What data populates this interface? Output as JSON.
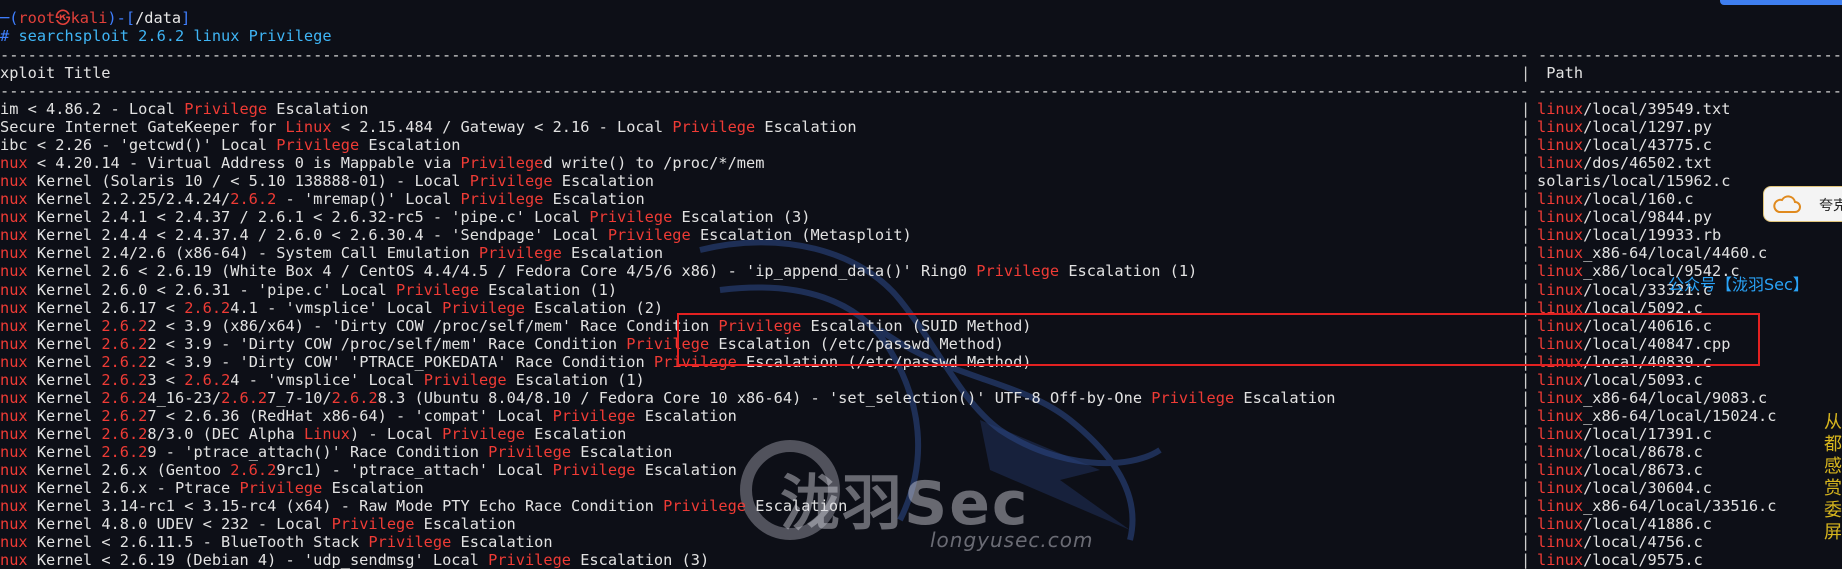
{
  "prompt": {
    "lead": "─(",
    "user": "root",
    "at": "㉿",
    "host": "kali",
    "mid": ")-[",
    "dir": "/data",
    "end": "]",
    "hash": "#",
    "command": "searchsploit 2.6.2 linux Privilege"
  },
  "header": {
    "title_col": "xploit Title",
    "path_col": "Path",
    "separator": "|"
  },
  "rows": [
    {
      "title": [
        [
          "im < 4.86.2 - Local ",
          0
        ],
        [
          "Privilege",
          1
        ],
        [
          " Escalation",
          0
        ]
      ],
      "path": [
        [
          "linux",
          1
        ],
        [
          "/local/39549.txt",
          0
        ]
      ]
    },
    {
      "title": [
        [
          "Secure Internet GateKeeper for ",
          0
        ],
        [
          "Linux",
          1
        ],
        [
          " < 2.15.484 / Gateway < 2.16 - Local ",
          0
        ],
        [
          "Privilege",
          1
        ],
        [
          " Escalation",
          0
        ]
      ],
      "path": [
        [
          "linux",
          1
        ],
        [
          "/local/1297.py",
          0
        ]
      ]
    },
    {
      "title": [
        [
          "ibc < 2.26 - 'getcwd()' Local ",
          0
        ],
        [
          "Privilege",
          1
        ],
        [
          " Escalation",
          0
        ]
      ],
      "path": [
        [
          "linux",
          1
        ],
        [
          "/local/43775.c",
          0
        ]
      ]
    },
    {
      "title": [
        [
          "nux",
          1
        ],
        [
          " < 4.20.14 - Virtual Address 0 is Mappable via ",
          0
        ],
        [
          "Privilege",
          1
        ],
        [
          "d write() to /proc/*/mem",
          0
        ]
      ],
      "path": [
        [
          "linux",
          1
        ],
        [
          "/dos/46502.txt",
          0
        ]
      ]
    },
    {
      "title": [
        [
          "nux",
          1
        ],
        [
          " Kernel (Solaris 10 / < 5.10 138888-01) - Local ",
          0
        ],
        [
          "Privilege",
          1
        ],
        [
          " Escalation",
          0
        ]
      ],
      "path": [
        [
          "solaris/local/15962.c",
          0
        ]
      ]
    },
    {
      "title": [
        [
          "nux",
          1
        ],
        [
          " Kernel 2.2.25/2.4.24/",
          0
        ],
        [
          "2.6.2",
          1
        ],
        [
          " - 'mremap()' Local ",
          0
        ],
        [
          "Privilege",
          1
        ],
        [
          " Escalation",
          0
        ]
      ],
      "path": [
        [
          "linux",
          1
        ],
        [
          "/local/160.c",
          0
        ]
      ]
    },
    {
      "title": [
        [
          "nux",
          1
        ],
        [
          " Kernel 2.4.1 < 2.4.37 / 2.6.1 < 2.6.32-rc5 - 'pipe.c' Local ",
          0
        ],
        [
          "Privilege",
          1
        ],
        [
          " Escalation (3)",
          0
        ]
      ],
      "path": [
        [
          "linux",
          1
        ],
        [
          "/local/9844.py",
          0
        ]
      ]
    },
    {
      "title": [
        [
          "nux",
          1
        ],
        [
          " Kernel 2.4.4 < 2.4.37.4 / 2.6.0 < 2.6.30.4 - 'Sendpage' Local ",
          0
        ],
        [
          "Privilege",
          1
        ],
        [
          " Escalation (Metasploit)",
          0
        ]
      ],
      "path": [
        [
          "linux",
          1
        ],
        [
          "/local/19933.rb",
          0
        ]
      ]
    },
    {
      "title": [
        [
          "nux",
          1
        ],
        [
          " Kernel 2.4/2.6 (x86-64) - System Call Emulation ",
          0
        ],
        [
          "Privilege",
          1
        ],
        [
          " Escalation",
          0
        ]
      ],
      "path": [
        [
          "linux",
          1
        ],
        [
          "_x86-64/local/4460.c",
          0
        ]
      ]
    },
    {
      "title": [
        [
          "nux",
          1
        ],
        [
          " Kernel 2.6 < 2.6.19 (White Box 4 / CentOS 4.4/4.5 / Fedora Core 4/5/6 x86) - 'ip_append_data()' Ring0 ",
          0
        ],
        [
          "Privilege",
          1
        ],
        [
          " Escalation (1)",
          0
        ]
      ],
      "path": [
        [
          "linux",
          1
        ],
        [
          "_x86/local/9542.c",
          0
        ]
      ]
    },
    {
      "title": [
        [
          "nux",
          1
        ],
        [
          " Kernel 2.6.0 < 2.6.31 - 'pipe.c' Local ",
          0
        ],
        [
          "Privilege",
          1
        ],
        [
          " Escalation (1)",
          0
        ]
      ],
      "path": [
        [
          "linux",
          1
        ],
        [
          "/local/33321.c",
          0
        ]
      ]
    },
    {
      "title": [
        [
          "nux",
          1
        ],
        [
          " Kernel 2.6.17 < ",
          0
        ],
        [
          "2.6.2",
          1
        ],
        [
          "4.1 - 'vmsplice' Local ",
          0
        ],
        [
          "Privilege",
          1
        ],
        [
          " Escalation (2)",
          0
        ]
      ],
      "path": [
        [
          "linux",
          1
        ],
        [
          "/local/5092.c",
          0
        ]
      ]
    },
    {
      "title": [
        [
          "nux",
          1
        ],
        [
          " Kernel ",
          0
        ],
        [
          "2.6.2",
          1
        ],
        [
          "2 < 3.9 (x86/x64) - 'Dirty COW /proc/self/mem' Race Condition ",
          0
        ],
        [
          "Privilege",
          1
        ],
        [
          " Escalation (SUID Method)",
          0
        ]
      ],
      "path": [
        [
          "linux",
          1
        ],
        [
          "/local/40616.c",
          0
        ]
      ]
    },
    {
      "title": [
        [
          "nux",
          1
        ],
        [
          " Kernel ",
          0
        ],
        [
          "2.6.2",
          1
        ],
        [
          "2 < 3.9 - 'Dirty COW /proc/self/mem' Race Condition ",
          0
        ],
        [
          "Privilege",
          1
        ],
        [
          " Escalation (/etc/passwd Method)",
          0
        ]
      ],
      "path": [
        [
          "linux",
          1
        ],
        [
          "/local/40847.cpp",
          0
        ]
      ]
    },
    {
      "title": [
        [
          "nux",
          1
        ],
        [
          " Kernel ",
          0
        ],
        [
          "2.6.2",
          1
        ],
        [
          "2 < 3.9 - 'Dirty COW' 'PTRACE_POKEDATA' Race Condition ",
          0
        ],
        [
          "Privilege",
          1
        ],
        [
          " Escalation (/etc/passwd Method)",
          0
        ]
      ],
      "path": [
        [
          "linux",
          1
        ],
        [
          "/local/40839.c",
          0
        ]
      ]
    },
    {
      "title": [
        [
          "nux",
          1
        ],
        [
          " Kernel ",
          0
        ],
        [
          "2.6.2",
          1
        ],
        [
          "3 < ",
          0
        ],
        [
          "2.6.2",
          1
        ],
        [
          "4 - 'vmsplice' Local ",
          0
        ],
        [
          "Privilege",
          1
        ],
        [
          " Escalation (1)",
          0
        ]
      ],
      "path": [
        [
          "linux",
          1
        ],
        [
          "/local/5093.c",
          0
        ]
      ]
    },
    {
      "title": [
        [
          "nux",
          1
        ],
        [
          " Kernel ",
          0
        ],
        [
          "2.6.2",
          1
        ],
        [
          "4_16-23/",
          0
        ],
        [
          "2.6.2",
          1
        ],
        [
          "7_7-10/",
          0
        ],
        [
          "2.6.2",
          1
        ],
        [
          "8.3 (Ubuntu 8.04/8.10 / Fedora Core 10 x86-64) - 'set_selection()' UTF-8 Off-by-One ",
          0
        ],
        [
          "Privilege",
          1
        ],
        [
          " Escalation",
          0
        ]
      ],
      "path": [
        [
          "linux",
          1
        ],
        [
          "_x86-64/local/9083.c",
          0
        ]
      ]
    },
    {
      "title": [
        [
          "nux",
          1
        ],
        [
          " Kernel ",
          0
        ],
        [
          "2.6.2",
          1
        ],
        [
          "7 < 2.6.36 (RedHat x86-64) - 'compat' Local ",
          0
        ],
        [
          "Privilege",
          1
        ],
        [
          " Escalation",
          0
        ]
      ],
      "path": [
        [
          "linux",
          1
        ],
        [
          "_x86-64/local/15024.c",
          0
        ]
      ]
    },
    {
      "title": [
        [
          "nux",
          1
        ],
        [
          " Kernel ",
          0
        ],
        [
          "2.6.2",
          1
        ],
        [
          "8/3.0 (DEC Alpha ",
          0
        ],
        [
          "Linux",
          1
        ],
        [
          ") - Local ",
          0
        ],
        [
          "Privilege",
          1
        ],
        [
          " Escalation",
          0
        ]
      ],
      "path": [
        [
          "linux",
          1
        ],
        [
          "/local/17391.c",
          0
        ]
      ]
    },
    {
      "title": [
        [
          "nux",
          1
        ],
        [
          " Kernel ",
          0
        ],
        [
          "2.6.2",
          1
        ],
        [
          "9 - 'ptrace_attach()' Race Condition ",
          0
        ],
        [
          "Privilege",
          1
        ],
        [
          " Escalation",
          0
        ]
      ],
      "path": [
        [
          "linux",
          1
        ],
        [
          "/local/8678.c",
          0
        ]
      ]
    },
    {
      "title": [
        [
          "nux",
          1
        ],
        [
          " Kernel 2.6.x (Gentoo ",
          0
        ],
        [
          "2.6.2",
          1
        ],
        [
          "9rc1) - 'ptrace_attach' Local ",
          0
        ],
        [
          "Privilege",
          1
        ],
        [
          " Escalation",
          0
        ]
      ],
      "path": [
        [
          "linux",
          1
        ],
        [
          "/local/8673.c",
          0
        ]
      ]
    },
    {
      "title": [
        [
          "nux",
          1
        ],
        [
          " Kernel 2.6.x - Ptrace ",
          0
        ],
        [
          "Privilege",
          1
        ],
        [
          " Escalation",
          0
        ]
      ],
      "path": [
        [
          "linux",
          1
        ],
        [
          "/local/30604.c",
          0
        ]
      ]
    },
    {
      "title": [
        [
          "nux",
          1
        ],
        [
          " Kernel 3.14-rc1 < 3.15-rc4 (x64) - Raw Mode PTY Echo Race Condition ",
          0
        ],
        [
          "Privilege",
          1
        ],
        [
          " Escalation",
          0
        ]
      ],
      "path": [
        [
          "linux",
          1
        ],
        [
          "_x86-64/local/33516.c",
          0
        ]
      ]
    },
    {
      "title": [
        [
          "nux",
          1
        ],
        [
          " Kernel 4.8.0 UDEV < 232 - Local ",
          0
        ],
        [
          "Privilege",
          1
        ],
        [
          " Escalation",
          0
        ]
      ],
      "path": [
        [
          "linux",
          1
        ],
        [
          "/local/41886.c",
          0
        ]
      ]
    },
    {
      "title": [
        [
          "nux",
          1
        ],
        [
          " Kernel < 2.6.11.5 - BlueTooth Stack ",
          0
        ],
        [
          "Privilege",
          1
        ],
        [
          " Escalation",
          0
        ]
      ],
      "path": [
        [
          "linux",
          1
        ],
        [
          "/local/4756.c",
          0
        ]
      ]
    },
    {
      "title": [
        [
          "nux",
          1
        ],
        [
          " Kernel < 2.6.19 (Debian 4) - 'udp_sendmsg' Local ",
          0
        ],
        [
          "Privilege",
          1
        ],
        [
          " Escalation (3)",
          0
        ]
      ],
      "path": [
        [
          "linux",
          1
        ],
        [
          "/local/9575.c",
          0
        ]
      ]
    }
  ],
  "overlay": {
    "watermark_brand": "泷羽Sec",
    "watermark_url": "longyusec.com",
    "wechat_tag": "公众号【泷羽Sec】",
    "side_widget_label": "夸克",
    "vertical_text": "从都感赏委屏"
  },
  "colors": {
    "background": "#0d0f17",
    "keyword_highlight": "#ef3b35",
    "prompt_blue": "#3f7fff",
    "box_red": "#e32121"
  }
}
